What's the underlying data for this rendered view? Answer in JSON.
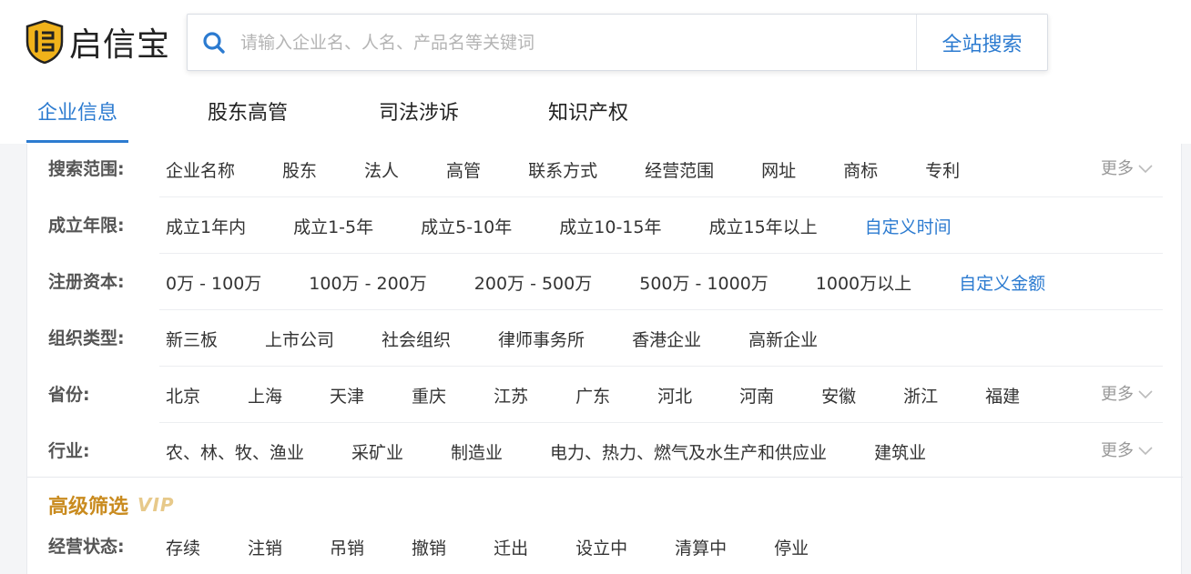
{
  "logo": {
    "text": "启信宝"
  },
  "search": {
    "placeholder": "请输入企业名、人名、产品名等关键词",
    "value": "",
    "button_label": "全站搜索"
  },
  "tabs": [
    {
      "label": "企业信息",
      "active": true
    },
    {
      "label": "股东高管",
      "active": false
    },
    {
      "label": "司法涉诉",
      "active": false
    },
    {
      "label": "知识产权",
      "active": false
    }
  ],
  "filters": {
    "scope": {
      "label": "搜索范围:",
      "options": [
        "企业名称",
        "股东",
        "法人",
        "高管",
        "联系方式",
        "经营范围",
        "网址",
        "商标",
        "专利"
      ],
      "more": "更多"
    },
    "years": {
      "label": "成立年限:",
      "options": [
        "成立1年内",
        "成立1-5年",
        "成立5-10年",
        "成立10-15年",
        "成立15年以上"
      ],
      "custom": "自定义时间"
    },
    "capital": {
      "label": "注册资本:",
      "options": [
        "0万 - 100万",
        "100万 - 200万",
        "200万 - 500万",
        "500万 - 1000万",
        "1000万以上"
      ],
      "custom": "自定义金额"
    },
    "org_type": {
      "label": "组织类型:",
      "options": [
        "新三板",
        "上市公司",
        "社会组织",
        "律师事务所",
        "香港企业",
        "高新企业"
      ]
    },
    "province": {
      "label": "省份:",
      "options": [
        "北京",
        "上海",
        "天津",
        "重庆",
        "江苏",
        "广东",
        "河北",
        "河南",
        "安徽",
        "浙江",
        "福建"
      ],
      "more": "更多"
    },
    "industry": {
      "label": "行业:",
      "options": [
        "农、林、牧、渔业",
        "采矿业",
        "制造业",
        "电力、热力、燃气及水生产和供应业",
        "建筑业"
      ],
      "more": "更多"
    }
  },
  "advanced": {
    "title": "高级筛选",
    "badge": "VIP",
    "status": {
      "label": "经营状态:",
      "options": [
        "存续",
        "注销",
        "吊销",
        "撤销",
        "迁出",
        "设立中",
        "清算中",
        "停业"
      ]
    }
  },
  "colors": {
    "accent": "#2c7bd0",
    "vip_gold": "#c98b1f",
    "logo_gold": "#f0b21a"
  }
}
